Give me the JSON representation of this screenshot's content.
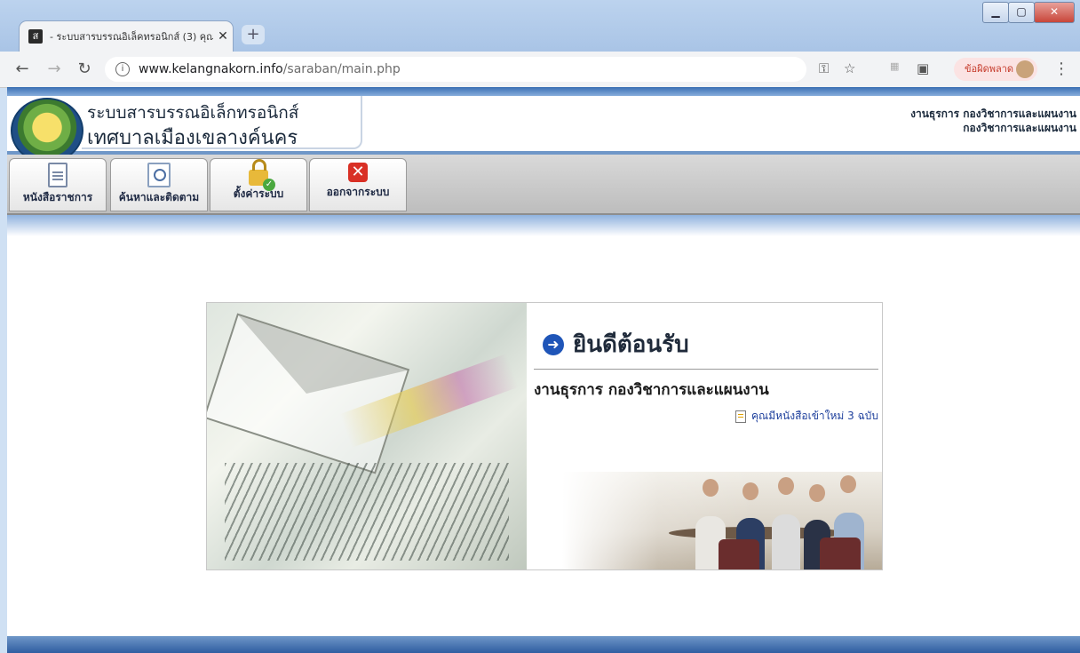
{
  "browser": {
    "tab_title": "- ระบบสารบรรณอิเล็คทรอนิกส์ (3) คุณ",
    "tab_favicon": "ส",
    "new_tab_label": "+",
    "url_host": "www.kelangnakorn.info",
    "url_path": "/saraban/main.php",
    "error_label": "ข้อผิดพลาด",
    "icons": [
      "back-icon",
      "forward-icon",
      "reload-icon",
      "info-icon",
      "key-icon",
      "star-icon",
      "extension-icon",
      "camera-icon",
      "menu-icon"
    ]
  },
  "header": {
    "title_line1": "ระบบสารบรรณอิเล็กทรอนิกส์",
    "title_line2": "เทศบาลเมืองเขลางค์นคร",
    "right_line1": "งานธุรการ กองวิชาการและแผนงาน",
    "right_line2": "กองวิชาการและแผนงาน"
  },
  "toolbar": {
    "items": [
      {
        "label": "หนังสือราชการ",
        "icon": "document-icon"
      },
      {
        "label": "ค้นหาและติดตาม",
        "icon": "search-document-icon"
      },
      {
        "label": "ตั้งค่าระบบ",
        "icon": "lock-check-icon"
      },
      {
        "label": "ออกจากระบบ",
        "icon": "exit-icon"
      }
    ]
  },
  "welcome": {
    "title": "ยินดีต้อนรับ",
    "department": "งานธุรการ กองวิชาการและแผนงาน",
    "new_docs_text": "คุณมีหนังสือเข้าใหม่ 3 ฉบับ"
  },
  "colors": {
    "header_blue": "#3a6fb3",
    "link_blue": "#1d3f9c",
    "error_red": "#c53929",
    "exit_red": "#d93025"
  }
}
